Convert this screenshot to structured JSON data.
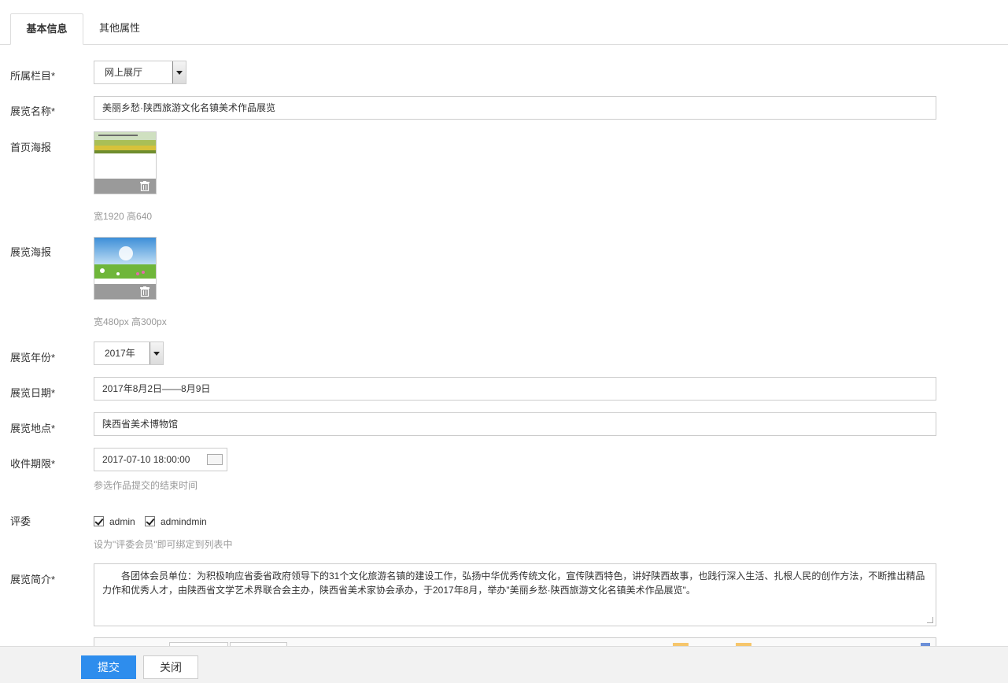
{
  "tabs": [
    {
      "label": "基本信息"
    },
    {
      "label": "其他属性"
    }
  ],
  "form": {
    "category": {
      "label": "所属栏目*",
      "value": "网上展厅"
    },
    "name": {
      "label": "展览名称*",
      "value": "美丽乡愁·陕西旅游文化名镇美术作品展览"
    },
    "home_poster": {
      "label": "首页海报",
      "hint": "宽1920 高640"
    },
    "exhibit_poster": {
      "label": "展览海报",
      "hint": "宽480px 高300px"
    },
    "year": {
      "label": "展览年份*",
      "value": "2017年"
    },
    "dates": {
      "label": "展览日期*",
      "value": "2017年8月2日——8月9日"
    },
    "location": {
      "label": "展览地点*",
      "value": "陕西省美术博物馆"
    },
    "deadline": {
      "label": "收件期限*",
      "value": "2017-07-10 18:00:00",
      "hint": "参选作品提交的结束时间"
    },
    "judges": {
      "label": "评委",
      "options": [
        {
          "label": "admin",
          "checked": true
        },
        {
          "label": "admindmin",
          "checked": true
        }
      ],
      "hint": "设为\"评委会员\"即可绑定到列表中"
    },
    "intro": {
      "label": "展览简介*",
      "value": "各团体会员单位：为积极响应省委省政府领导下的31个文化旅游名镇的建设工作，弘扬中华优秀传统文化，宣传陕西特色，讲好陕西故事，也践行深入生活、扎根人民的创作方法，不断推出精品力作和优秀人才，由陕西省文学艺术界联合会主办，陕西省美术家协会承办，于2017年8月，举办\"美丽乡愁·陕西旅游文化名镇美术作品展览\"。"
    }
  },
  "footer": {
    "submit_label": "提交",
    "close_label": "关闭"
  },
  "colors": {
    "primary": "#2e8ded",
    "border": "#cccccc",
    "hint": "#999999"
  }
}
